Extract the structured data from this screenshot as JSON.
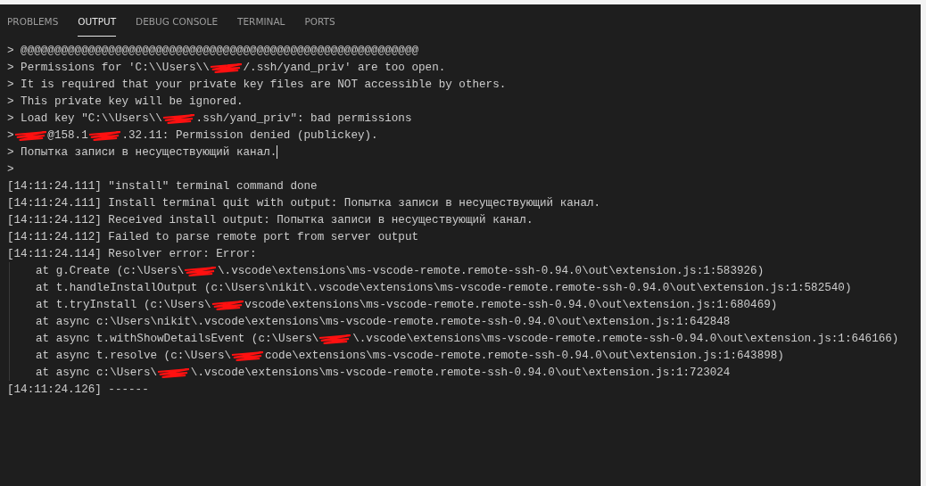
{
  "tabs": [
    {
      "label": "PROBLEMS",
      "selected": false
    },
    {
      "label": "OUTPUT",
      "selected": true
    },
    {
      "label": "DEBUG CONSOLE",
      "selected": false
    },
    {
      "label": "TERMINAL",
      "selected": false
    },
    {
      "label": "PORTS",
      "selected": false
    }
  ],
  "lines": [
    {
      "kind": "prompt",
      "segments": [
        {
          "kind": "text",
          "text": "> @@@@@@@@@@@@@@@@@@@@@@@@@@@@@@@@@@@@@@@@@@@@@@@@@@@@@@@@@@@"
        }
      ]
    },
    {
      "kind": "prompt",
      "segments": [
        {
          "kind": "text",
          "text": "> Permissions for 'C:\\\\Users\\\\"
        },
        {
          "kind": "redaction"
        },
        {
          "kind": "text",
          "text": "/.ssh/yand_priv' are too open."
        }
      ]
    },
    {
      "kind": "prompt",
      "segments": [
        {
          "kind": "text",
          "text": "> It is required that your private key files are NOT accessible by others."
        }
      ]
    },
    {
      "kind": "prompt",
      "segments": [
        {
          "kind": "text",
          "text": "> This private key will be ignored."
        }
      ]
    },
    {
      "kind": "prompt",
      "segments": [
        {
          "kind": "text",
          "text": "> Load key \"C:\\\\Users\\\\"
        },
        {
          "kind": "redaction"
        },
        {
          "kind": "text",
          "text": ".ssh/yand_priv\": bad permissions"
        }
      ]
    },
    {
      "kind": "prompt",
      "segments": [
        {
          "kind": "text",
          "text": ">"
        },
        {
          "kind": "redaction"
        },
        {
          "kind": "text",
          "text": "@158.1"
        },
        {
          "kind": "redaction"
        },
        {
          "kind": "text",
          "text": ".32.11: Permission denied (publickey)."
        }
      ]
    },
    {
      "kind": "prompt",
      "cursor": true,
      "segments": [
        {
          "kind": "text",
          "text": "> Попытка записи в несуществующий канал."
        }
      ]
    },
    {
      "kind": "prompt",
      "segments": [
        {
          "kind": "text",
          "text": ">"
        }
      ]
    },
    {
      "kind": "log",
      "segments": [
        {
          "kind": "text",
          "text": "[14:11:24.111] \"install\" terminal command done"
        }
      ]
    },
    {
      "kind": "log",
      "segments": [
        {
          "kind": "text",
          "text": "[14:11:24.111] Install terminal quit with output: Попытка записи в несуществующий канал."
        }
      ]
    },
    {
      "kind": "log",
      "segments": [
        {
          "kind": "text",
          "text": "[14:11:24.112] Received install output: Попытка записи в несуществующий канал."
        }
      ]
    },
    {
      "kind": "log",
      "segments": [
        {
          "kind": "text",
          "text": "[14:11:24.112] Failed to parse remote port from server output"
        }
      ]
    },
    {
      "kind": "log",
      "segments": [
        {
          "kind": "text",
          "text": "[14:11:24.114] Resolver error: Error:"
        }
      ]
    },
    {
      "kind": "trace",
      "segments": [
        {
          "kind": "text",
          "text": "at g.Create (c:\\Users\\"
        },
        {
          "kind": "redaction"
        },
        {
          "kind": "text",
          "text": "\\.vscode\\extensions\\ms-vscode-remote.remote-ssh-0.94.0\\out\\extension.js:1:583926)"
        }
      ]
    },
    {
      "kind": "trace",
      "segments": [
        {
          "kind": "text",
          "text": "at t.handleInstallOutput (c:\\Users\\nikit\\.vscode\\extensions\\ms-vscode-remote.remote-ssh-0.94.0\\out\\extension.js:1:582540)"
        }
      ]
    },
    {
      "kind": "trace",
      "segments": [
        {
          "kind": "text",
          "text": "at t.tryInstall (c:\\Users\\"
        },
        {
          "kind": "redaction"
        },
        {
          "kind": "text",
          "text": "vscode\\extensions\\ms-vscode-remote.remote-ssh-0.94.0\\out\\extension.js:1:680469)"
        }
      ]
    },
    {
      "kind": "trace",
      "segments": [
        {
          "kind": "text",
          "text": "at async c:\\Users\\nikit\\.vscode\\extensions\\ms-vscode-remote.remote-ssh-0.94.0\\out\\extension.js:1:642848"
        }
      ]
    },
    {
      "kind": "trace",
      "segments": [
        {
          "kind": "text",
          "text": "at async t.withShowDetailsEvent (c:\\Users\\"
        },
        {
          "kind": "redaction"
        },
        {
          "kind": "text",
          "text": "\\.vscode\\extensions\\ms-vscode-remote.remote-ssh-0.94.0\\out\\extension.js:1:646166)"
        }
      ]
    },
    {
      "kind": "trace",
      "segments": [
        {
          "kind": "text",
          "text": "at async t.resolve (c:\\Users\\"
        },
        {
          "kind": "redaction"
        },
        {
          "kind": "text",
          "text": "code\\extensions\\ms-vscode-remote.remote-ssh-0.94.0\\out\\extension.js:1:643898)"
        }
      ]
    },
    {
      "kind": "trace",
      "segments": [
        {
          "kind": "text",
          "text": "at async c:\\Users\\"
        },
        {
          "kind": "redaction"
        },
        {
          "kind": "text",
          "text": "\\.vscode\\extensions\\ms-vscode-remote.remote-ssh-0.94.0\\out\\extension.js:1:723024"
        }
      ]
    },
    {
      "kind": "log",
      "segments": [
        {
          "kind": "text",
          "text": "[14:11:24.126] ------"
        }
      ]
    }
  ]
}
